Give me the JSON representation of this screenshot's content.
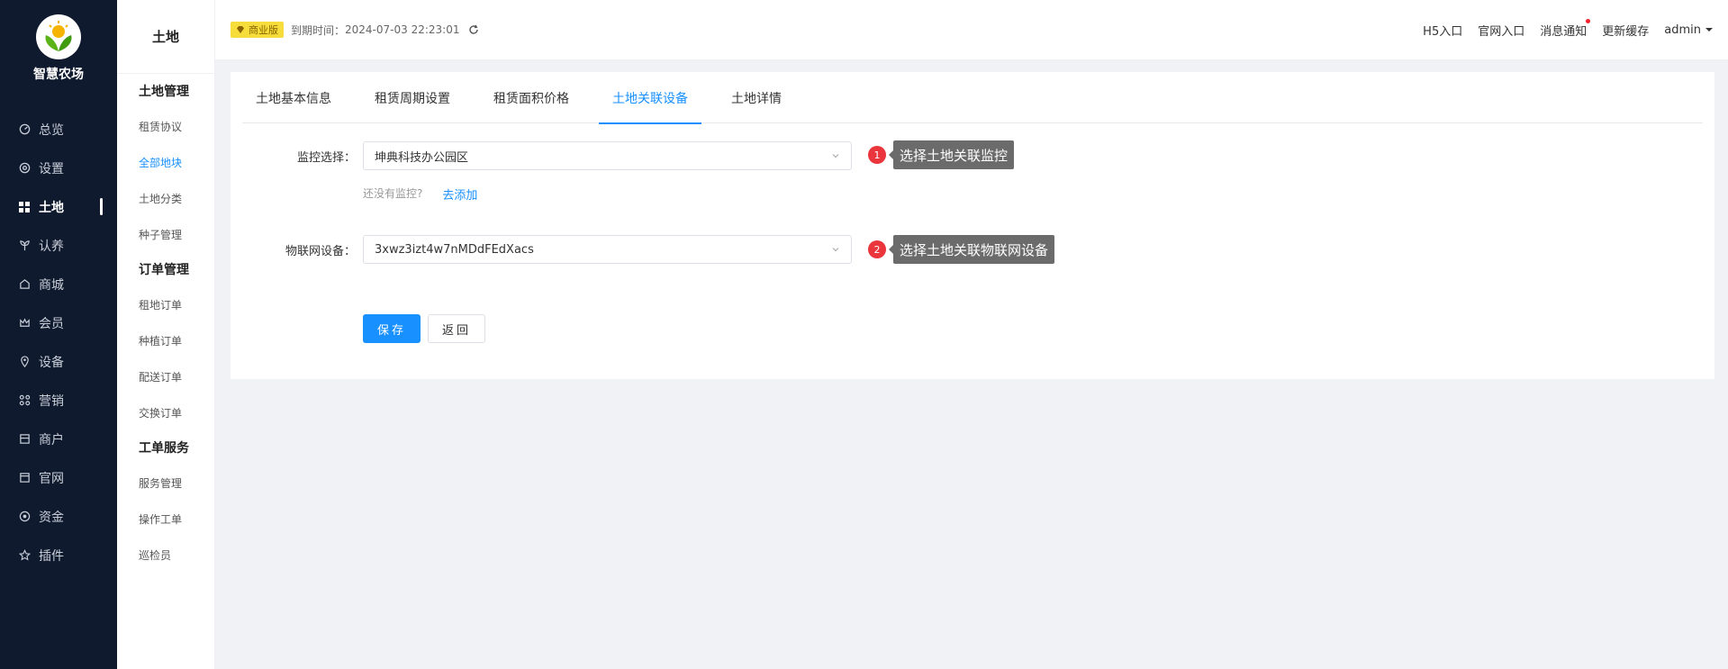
{
  "app": {
    "name": "智慧农场"
  },
  "nav": [
    {
      "label": "总览",
      "icon": "dashboard-icon",
      "active": false
    },
    {
      "label": "设置",
      "icon": "gear-icon",
      "active": false
    },
    {
      "label": "土地",
      "icon": "grid-icon",
      "active": true
    },
    {
      "label": "认养",
      "icon": "sprout-icon",
      "active": false
    },
    {
      "label": "商城",
      "icon": "store-icon",
      "active": false
    },
    {
      "label": "会员",
      "icon": "crown-icon",
      "active": false
    },
    {
      "label": "设备",
      "icon": "location-icon",
      "active": false
    },
    {
      "label": "营销",
      "icon": "command-icon",
      "active": false
    },
    {
      "label": "商户",
      "icon": "shop-icon",
      "active": false
    },
    {
      "label": "官网",
      "icon": "window-icon",
      "active": false
    },
    {
      "label": "资金",
      "icon": "target-icon",
      "active": false
    },
    {
      "label": "插件",
      "icon": "star-icon",
      "active": false
    }
  ],
  "subnav": {
    "title": "土地",
    "groups": [
      {
        "title": "土地管理",
        "items": [
          {
            "label": "租赁协议",
            "active": false
          },
          {
            "label": "全部地块",
            "active": true
          },
          {
            "label": "土地分类",
            "active": false
          },
          {
            "label": "种子管理",
            "active": false
          }
        ]
      },
      {
        "title": "订单管理",
        "items": [
          {
            "label": "租地订单",
            "active": false
          },
          {
            "label": "种植订单",
            "active": false
          },
          {
            "label": "配送订单",
            "active": false
          },
          {
            "label": "交换订单",
            "active": false
          }
        ]
      },
      {
        "title": "工单服务",
        "items": [
          {
            "label": "服务管理",
            "active": false
          },
          {
            "label": "操作工单",
            "active": false
          },
          {
            "label": "巡检员",
            "active": false
          }
        ]
      }
    ]
  },
  "header": {
    "edition_badge": "商业版",
    "expire_label": "到期时间：",
    "expire_time": "2024-07-03 22:23:01",
    "links": [
      "H5入口",
      "官网入口",
      "消息通知",
      "更新缓存"
    ],
    "user": "admin"
  },
  "tabs": [
    {
      "label": "土地基本信息",
      "active": false
    },
    {
      "label": "租赁周期设置",
      "active": false
    },
    {
      "label": "租赁面积价格",
      "active": false
    },
    {
      "label": "土地关联设备",
      "active": true
    },
    {
      "label": "土地详情",
      "active": false
    }
  ],
  "form": {
    "monitor_label": "监控选择：",
    "monitor_value": "坤典科技办公园区",
    "monitor_hint": "还没有监控?",
    "monitor_add": "去添加",
    "iot_label": "物联网设备：",
    "iot_value": "3xwz3izt4w7nMDdFEdXacs",
    "save": "保存",
    "back": "返回"
  },
  "annotations": [
    {
      "num": "1",
      "text": "选择土地关联监控"
    },
    {
      "num": "2",
      "text": "选择土地关联物联网设备"
    }
  ],
  "colors": {
    "accent": "#1890ff",
    "sidebar": "#0f1a2e",
    "annotation": "#e9353b",
    "badge": "#f7dd3b"
  }
}
